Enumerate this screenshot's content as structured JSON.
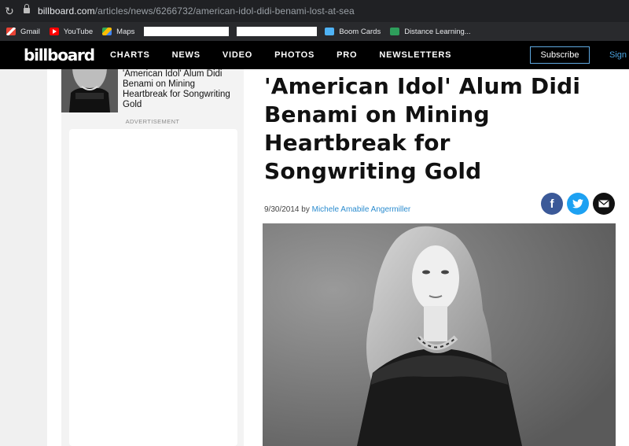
{
  "browser": {
    "url_host": "billboard.com",
    "url_path": "/articles/news/6266732/american-idol-didi-benami-lost-at-sea",
    "bookmarks": [
      {
        "label": "Gmail",
        "icon": "gmail-icon"
      },
      {
        "label": "YouTube",
        "icon": "youtube-icon"
      },
      {
        "label": "Maps",
        "icon": "maps-icon"
      },
      {
        "label": "Boom Cards",
        "icon": "boom-cards-icon"
      },
      {
        "label": "Distance Learning...",
        "icon": "distance-learning-icon"
      }
    ]
  },
  "nav": {
    "logo": "billboard",
    "links": [
      "CHARTS",
      "NEWS",
      "VIDEO",
      "PHOTOS",
      "PRO",
      "NEWSLETTERS"
    ],
    "subscribe": "Subscribe",
    "signin": "Sign in"
  },
  "sidebar": {
    "related_title": "'American Idol' Alum Didi Benami on Mining Heartbreak for Songwriting Gold",
    "ad_label": "ADVERTISEMENT"
  },
  "article": {
    "headline": "'American Idol' Alum Didi Benami on Mining Heartbreak for Songwriting Gold",
    "date": "9/30/2014",
    "by": "by",
    "author": "Michele Amabile Angermiller"
  },
  "share": {
    "facebook_icon": "facebook-icon",
    "twitter_icon": "twitter-icon",
    "email_icon": "email-icon"
  }
}
